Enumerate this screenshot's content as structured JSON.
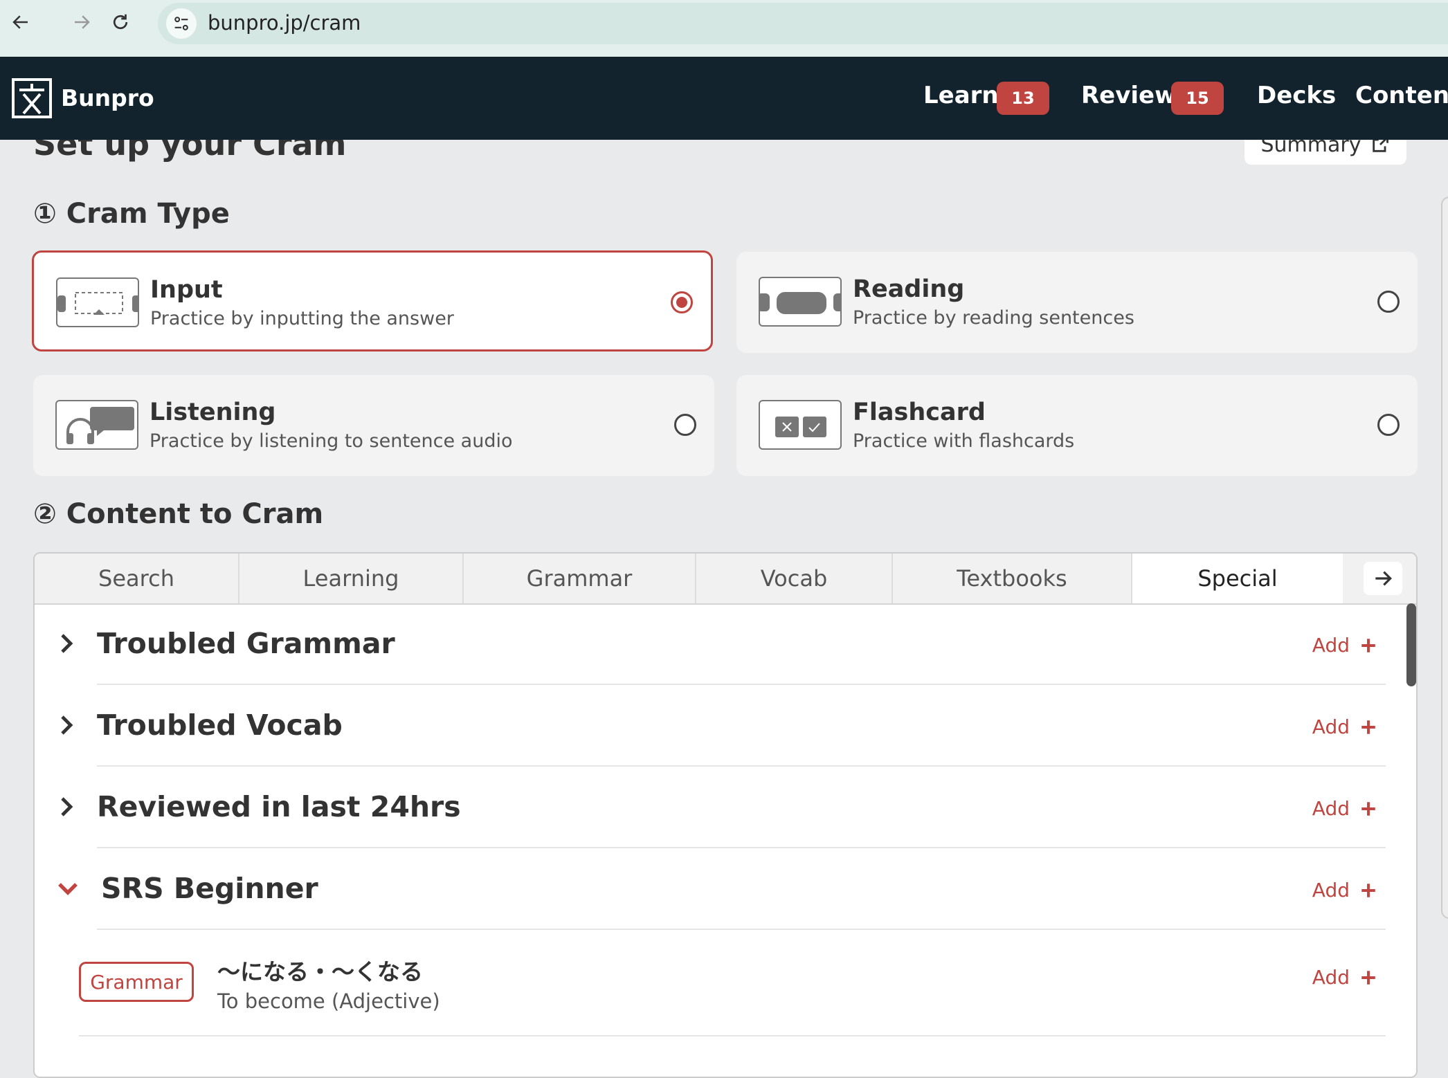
{
  "browser": {
    "url": "bunpro.jp/cram"
  },
  "header": {
    "brand": "Bunpro",
    "nav": [
      {
        "label": "Learn",
        "badge": "13"
      },
      {
        "label": "Review",
        "badge": "15"
      },
      {
        "label": "Decks"
      },
      {
        "label": "Content"
      }
    ],
    "accent": "#c0443f",
    "bg": "#12232e"
  },
  "page": {
    "title": "Set up your Cram",
    "summary_label": "Summary"
  },
  "cram_type": {
    "heading": "① Cram Type",
    "options": [
      {
        "title": "Input",
        "desc": "Practice by inputting the answer",
        "selected": true,
        "icon": "input-icon"
      },
      {
        "title": "Reading",
        "desc": "Practice by reading sentences",
        "selected": false,
        "icon": "reading-icon"
      },
      {
        "title": "Listening",
        "desc": "Practice by listening to sentence audio",
        "selected": false,
        "icon": "listening-icon"
      },
      {
        "title": "Flashcard",
        "desc": "Practice with flashcards",
        "selected": false,
        "icon": "flashcard-icon"
      }
    ]
  },
  "content": {
    "heading": "② Content to Cram",
    "tabs": [
      "Search",
      "Learning",
      "Grammar",
      "Vocab",
      "Textbooks",
      "Special"
    ],
    "active_tab": "Special",
    "add_label": "Add",
    "rows": [
      {
        "title": "Troubled Grammar",
        "expanded": false
      },
      {
        "title": "Troubled Vocab",
        "expanded": false
      },
      {
        "title": "Reviewed in last 24hrs",
        "expanded": false
      },
      {
        "title": "SRS Beginner",
        "expanded": true
      }
    ],
    "items": [
      {
        "tag": "Grammar",
        "jp": "〜になる・〜くなる",
        "en": "To become (Adjective)"
      }
    ]
  }
}
